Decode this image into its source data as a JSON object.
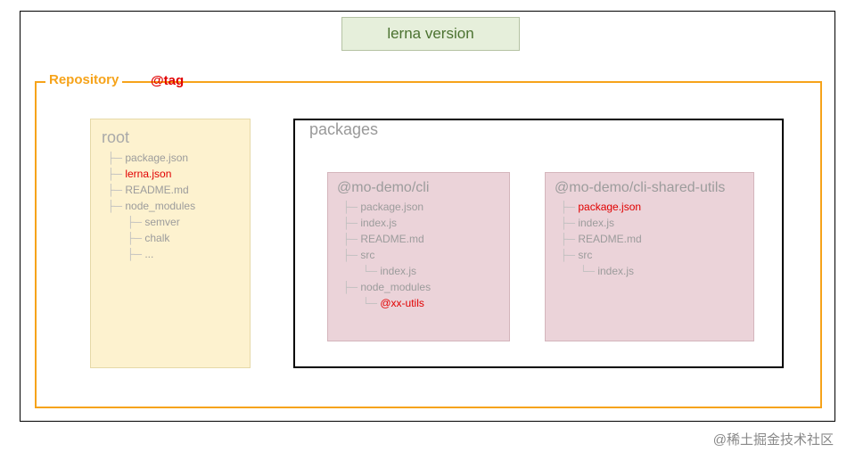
{
  "command": "lerna version",
  "repository_label": "Repository",
  "tag_label": "@tag",
  "packages_label": "packages",
  "watermark": "@稀土掘金技术社区",
  "root": {
    "title": "root",
    "items": [
      {
        "name": "package.json",
        "red": false,
        "indent": 0
      },
      {
        "name": "lerna.json",
        "red": true,
        "indent": 0
      },
      {
        "name": "README.md",
        "red": false,
        "indent": 0
      },
      {
        "name": "node_modules",
        "red": false,
        "indent": 0
      },
      {
        "name": "semver",
        "red": false,
        "indent": 1
      },
      {
        "name": "chalk",
        "red": false,
        "indent": 1
      },
      {
        "name": "...",
        "red": false,
        "indent": 1
      }
    ]
  },
  "packages": [
    {
      "title": "@mo-demo/cli",
      "items": [
        {
          "name": "package.json",
          "red": false,
          "indent": 0
        },
        {
          "name": "index.js",
          "red": false,
          "indent": 0
        },
        {
          "name": "README.md",
          "red": false,
          "indent": 0
        },
        {
          "name": "src",
          "red": false,
          "indent": 0
        },
        {
          "name": "index.js",
          "red": false,
          "indent": 1,
          "last": true
        },
        {
          "name": "node_modules",
          "red": false,
          "indent": 0
        },
        {
          "name": "@xx-utils",
          "red": true,
          "indent": 1,
          "last": true
        }
      ]
    },
    {
      "title": "@mo-demo/cli-shared-utils",
      "items": [
        {
          "name": "package.json",
          "red": true,
          "indent": 0
        },
        {
          "name": "index.js",
          "red": false,
          "indent": 0
        },
        {
          "name": "README.md",
          "red": false,
          "indent": 0
        },
        {
          "name": "src",
          "red": false,
          "indent": 0
        },
        {
          "name": "index.js",
          "red": false,
          "indent": 1,
          "last": true
        }
      ]
    }
  ]
}
